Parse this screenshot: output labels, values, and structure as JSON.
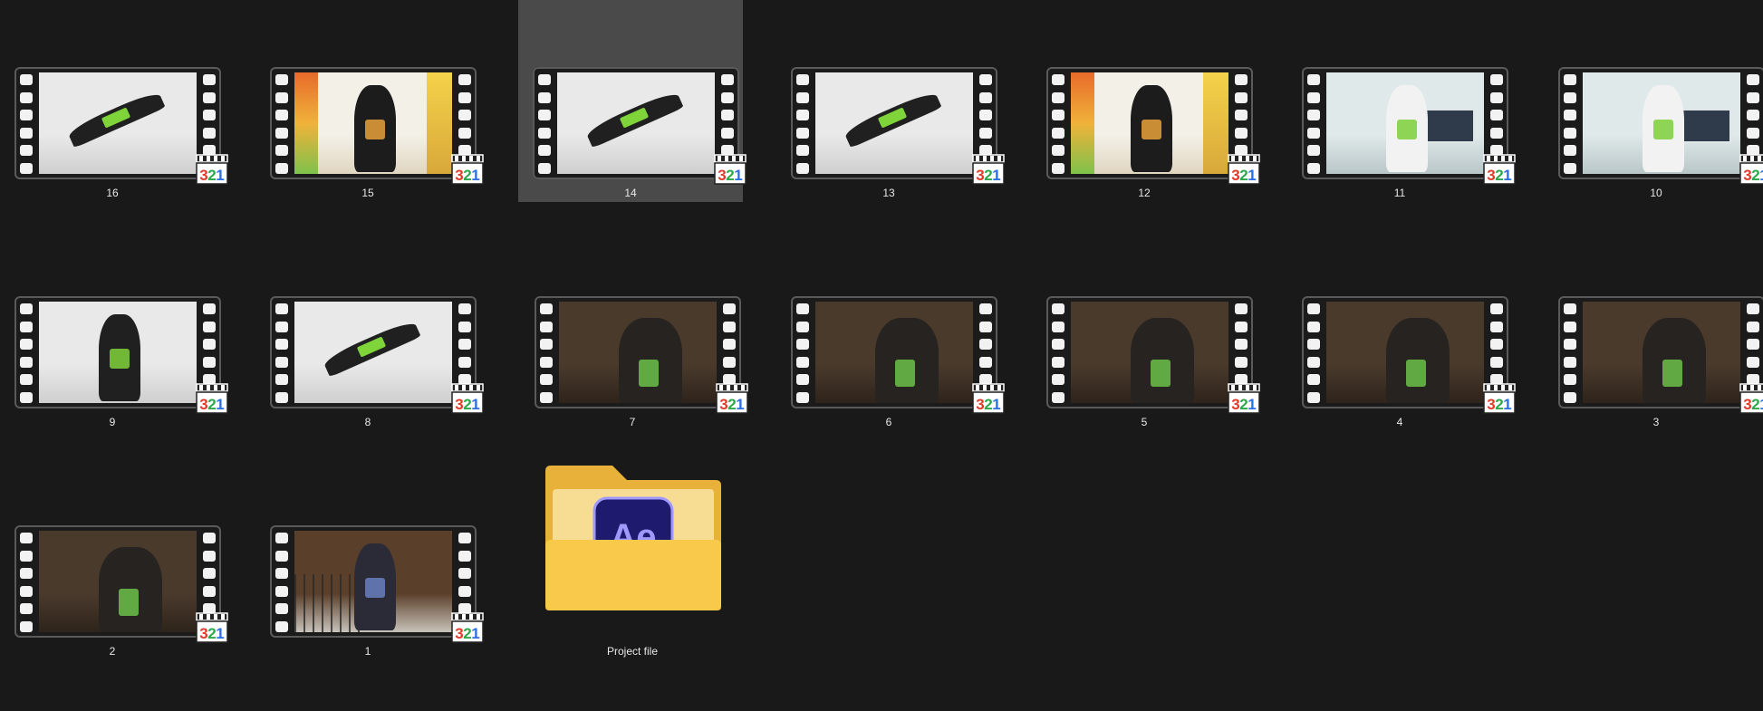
{
  "window": {
    "view": "large-icons"
  },
  "items": [
    {
      "label": "16",
      "type": "video",
      "theme": "light",
      "selected": false
    },
    {
      "label": "15",
      "type": "video",
      "theme": "art",
      "selected": false
    },
    {
      "label": "14",
      "type": "video",
      "theme": "light",
      "selected": true
    },
    {
      "label": "13",
      "type": "video",
      "theme": "light",
      "selected": false
    },
    {
      "label": "12",
      "type": "video",
      "theme": "art",
      "selected": false
    },
    {
      "label": "11",
      "type": "video",
      "theme": "office",
      "selected": false
    },
    {
      "label": "10",
      "type": "video",
      "theme": "office",
      "selected": false
    },
    {
      "label": "9",
      "type": "video",
      "theme": "light",
      "selected": false
    },
    {
      "label": "8",
      "type": "video",
      "theme": "light",
      "selected": false
    },
    {
      "label": "7",
      "type": "video",
      "theme": "dark",
      "selected": false
    },
    {
      "label": "6",
      "type": "video",
      "theme": "dark",
      "selected": false
    },
    {
      "label": "5",
      "type": "video",
      "theme": "dark",
      "selected": false
    },
    {
      "label": "4",
      "type": "video",
      "theme": "dark",
      "selected": false
    },
    {
      "label": "3",
      "type": "video",
      "theme": "dark",
      "selected": false
    },
    {
      "label": "2",
      "type": "video",
      "theme": "dark",
      "selected": false
    },
    {
      "label": "1",
      "type": "video",
      "theme": "stairs",
      "selected": false
    }
  ],
  "folder": {
    "label": "Project file",
    "badge_text": "Ae",
    "icon": "folder-ae-icon"
  },
  "badge": {
    "text_a": "3",
    "text_b": "2",
    "text_c": "1",
    "icon": "media-player-classic-icon"
  },
  "colors": {
    "background": "#191919",
    "selection": "#4a4a4a",
    "folder": "#f8c94a",
    "ae_badge": "#1e1a6e",
    "ae_text": "#9f99ff"
  }
}
